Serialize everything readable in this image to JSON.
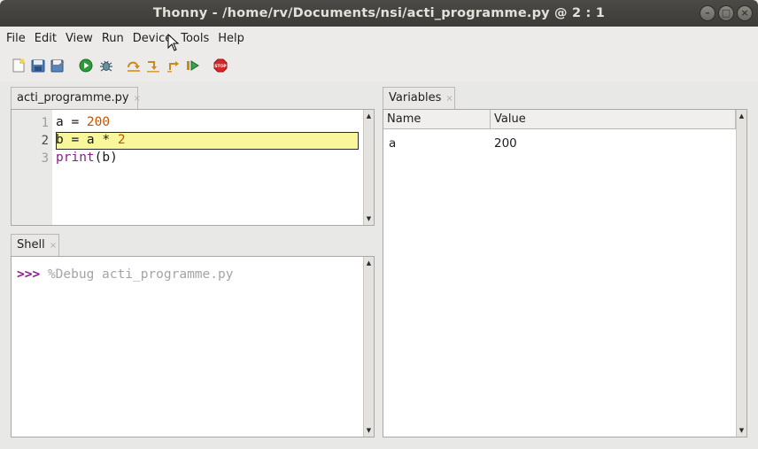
{
  "window": {
    "title": "Thonny  -  /home/rv/Documents/nsi/acti_programme.py  @  2 : 1",
    "buttons": [
      "minimize-icon",
      "maximize-icon",
      "close-icon"
    ]
  },
  "menubar": {
    "items": [
      "File",
      "Edit",
      "View",
      "Run",
      "Device",
      "Tools",
      "Help"
    ]
  },
  "toolbar": {
    "buttons": [
      "new-file-icon",
      "open-file-icon",
      "save-file-icon",
      "run-icon",
      "debug-icon",
      "step-over-icon",
      "step-into-icon",
      "step-out-icon",
      "resume-icon",
      "stop-icon"
    ]
  },
  "editor": {
    "tab_label": "acti_programme.py",
    "current_line": 2,
    "lines": [
      {
        "num": "1",
        "code": "a = 200"
      },
      {
        "num": "2",
        "code": "b = a * 2"
      },
      {
        "num": "3",
        "code": "print(b)"
      }
    ]
  },
  "shell": {
    "tab_label": "Shell",
    "prompt": ">>>",
    "command": "%Debug acti_programme.py"
  },
  "variables": {
    "tab_label": "Variables",
    "columns": [
      "Name",
      "Value"
    ],
    "rows": [
      {
        "name": "a",
        "value": "200"
      }
    ]
  },
  "colors": {
    "highlight": "#f9f79c",
    "number": "#c25500",
    "builtin": "#8b1d8b",
    "prompt": "#8b1d8b"
  }
}
